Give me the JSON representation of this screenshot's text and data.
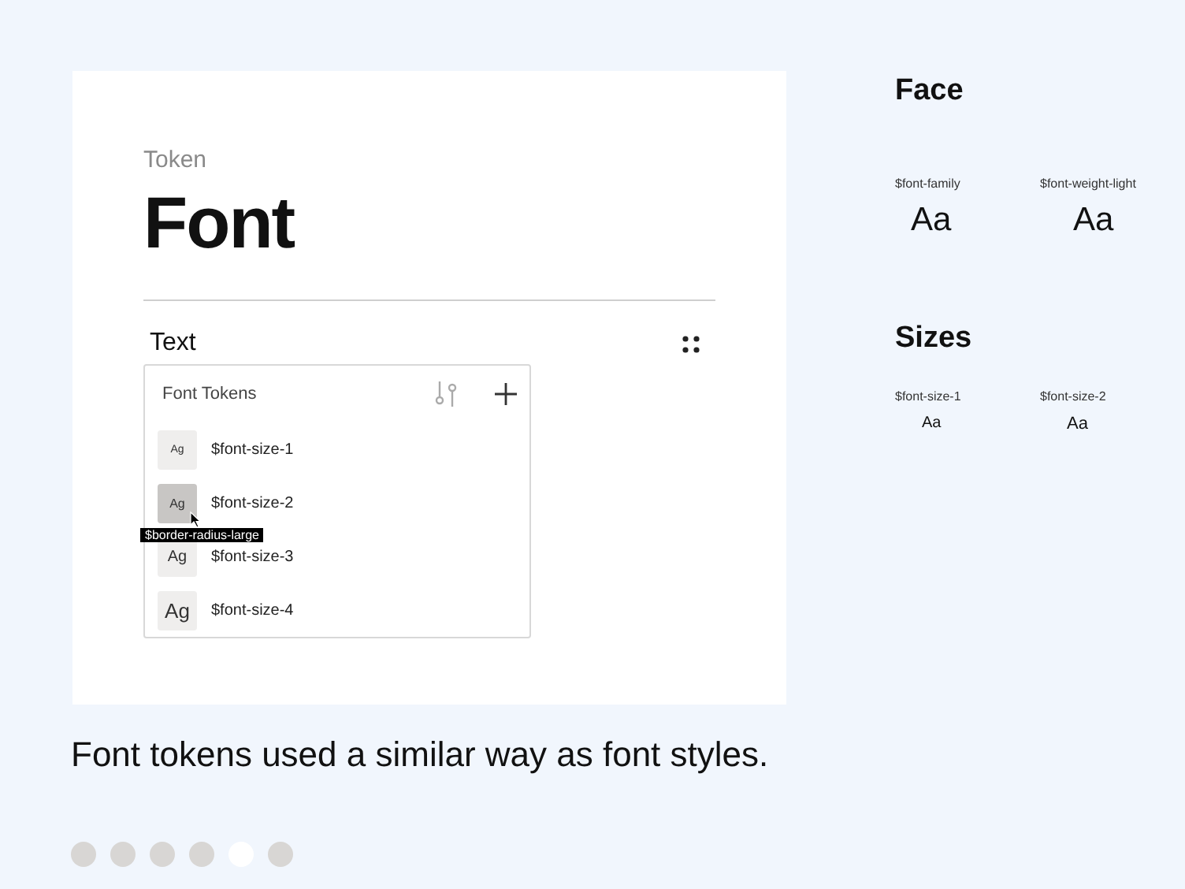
{
  "card": {
    "eyebrow": "Token",
    "title": "Font",
    "section": {
      "title": "Text",
      "panel": {
        "title": "Font Tokens",
        "tokens": [
          {
            "swatch": "Ag",
            "name": "$font-size-1",
            "selected": false
          },
          {
            "swatch": "Ag",
            "name": "$font-size-2",
            "selected": true
          },
          {
            "swatch": "Ag",
            "name": "$font-size-3",
            "selected": false
          },
          {
            "swatch": "Ag",
            "name": "$font-size-4",
            "selected": false
          }
        ],
        "tooltip": "$border-radius-large"
      }
    }
  },
  "caption": "Font tokens used a similar way as font styles.",
  "side": {
    "sections": [
      {
        "title": "Face",
        "samples": [
          {
            "label": "$font-family",
            "sample": "Aa"
          },
          {
            "label": "$font-weight-light",
            "sample": "Aa"
          }
        ]
      },
      {
        "title": "Sizes",
        "samples": [
          {
            "label": "$font-size-1",
            "sample": "Aa"
          },
          {
            "label": "$font-size-2",
            "sample": "Aa"
          }
        ]
      }
    ]
  },
  "pager": [
    {
      "selected": false
    },
    {
      "selected": false
    },
    {
      "selected": false
    },
    {
      "selected": false
    },
    {
      "selected": true
    },
    {
      "selected": false
    }
  ]
}
